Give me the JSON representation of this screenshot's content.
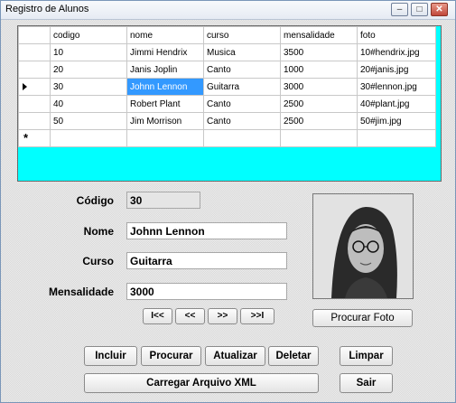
{
  "window": {
    "title": "Registro de Alunos",
    "min": "–",
    "max": "□",
    "close": "✕"
  },
  "grid": {
    "columns": [
      "codigo",
      "nome",
      "curso",
      "mensalidade",
      "foto"
    ],
    "rows": [
      [
        "10",
        "Jimmi Hendrix",
        "Musica",
        "3500",
        "10#hendrix.jpg"
      ],
      [
        "20",
        "Janis Joplin",
        "Canto",
        "1000",
        "20#janis.jpg"
      ],
      [
        "30",
        "Johnn Lennon",
        "Guitarra",
        "3000",
        "30#lennon.jpg"
      ],
      [
        "40",
        "Robert Plant",
        "Canto",
        "2500",
        "40#plant.jpg"
      ],
      [
        "50",
        "Jim Morrison",
        "Canto",
        "2500",
        "50#jim.jpg"
      ]
    ],
    "new_row_marker": "*",
    "selected_row": 2,
    "selected_col": 1
  },
  "form": {
    "codigo_label": "Código",
    "codigo_value": "30",
    "nome_label": "Nome",
    "nome_value": "Johnn Lennon",
    "curso_label": "Curso",
    "curso_value": "Guitarra",
    "mensalidade_label": "Mensalidade",
    "mensalidade_value": "3000"
  },
  "nav": {
    "first": "I<<",
    "prev": "<<",
    "next": ">>",
    "last": ">>I"
  },
  "buttons": {
    "procurar_foto": "Procurar Foto",
    "incluir": "Incluir",
    "procurar": "Procurar",
    "atualizar": "Atualizar",
    "deletar": "Deletar",
    "limpar": "Limpar",
    "carregar_xml": "Carregar Arquivo XML",
    "sair": "Sair"
  }
}
